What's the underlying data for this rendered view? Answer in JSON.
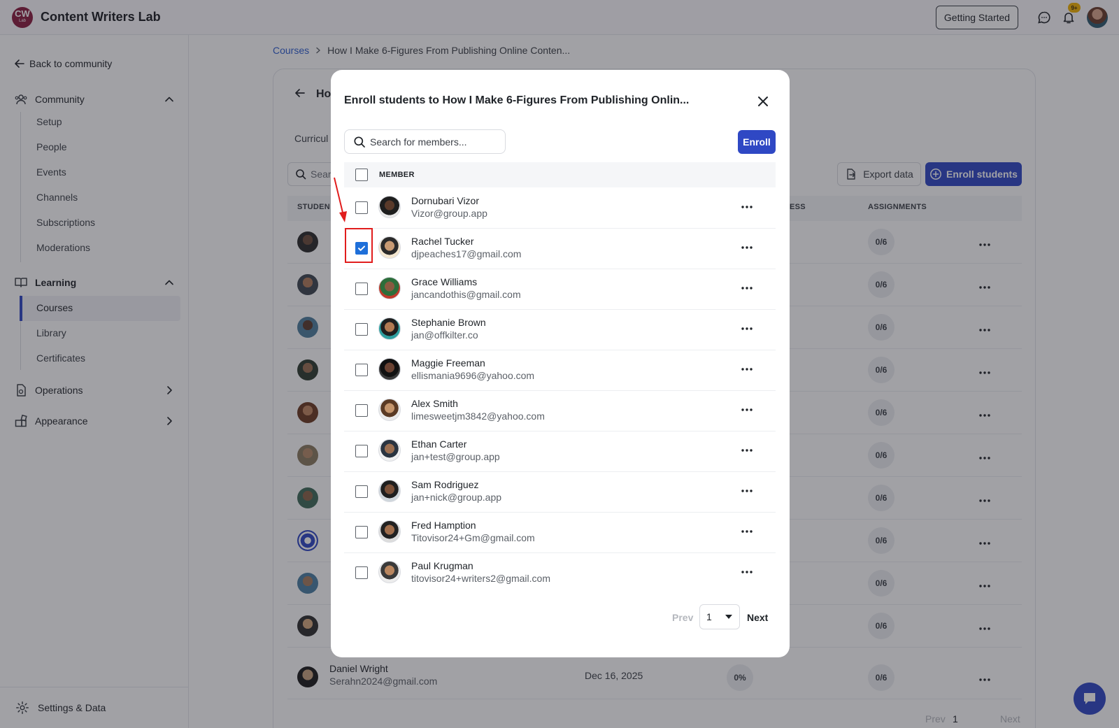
{
  "topbar": {
    "logo_text": "CW",
    "logo_sub": "Lab",
    "brand_name": "Content Writers Lab",
    "getting_started": "Getting Started",
    "notif_badge": "9+"
  },
  "sidebar": {
    "back_label": "Back to community",
    "community": {
      "label": "Community",
      "items": [
        "Setup",
        "People",
        "Events",
        "Channels",
        "Subscriptions",
        "Moderations"
      ]
    },
    "learning": {
      "label": "Learning",
      "items": [
        "Courses",
        "Library",
        "Certificates"
      ],
      "active": "Courses"
    },
    "operations": "Operations",
    "appearance": "Appearance",
    "settings": "Settings & Data"
  },
  "main": {
    "breadcrumb_root": "Courses",
    "breadcrumb_current": "How I Make 6-Figures From Publishing Online Conten...",
    "title_partial": "Ho",
    "tab_partial": "Curricul",
    "search_partial": "Sear",
    "export_label": "Export data",
    "enroll_students_label": "Enroll students",
    "columns": {
      "student": "STUDEN",
      "progress": "ESS",
      "assignments": "ASSIGNMENTS"
    },
    "assignments_value": "0/6",
    "last_row": {
      "name": "Daniel Wright",
      "email": "Serahn2024@gmail.com",
      "date": "Dec 16, 2025",
      "progress": "0%",
      "assignments": "0/6"
    },
    "pager": {
      "prev": "Prev",
      "page": "1",
      "next": "Next"
    }
  },
  "modal": {
    "title": "Enroll students to How I Make 6-Figures From Publishing Onlin...",
    "search_placeholder": "Search for members...",
    "enroll_label": "Enroll",
    "column_member": "MEMBER",
    "members": [
      {
        "name": "Dornubari Vizor",
        "email": "Vizor@group.app",
        "checked": false
      },
      {
        "name": "Rachel Tucker",
        "email": "djpeaches17@gmail.com",
        "checked": true
      },
      {
        "name": "Grace Williams",
        "email": "jancandothis@gmail.com",
        "checked": false
      },
      {
        "name": "Stephanie Brown",
        "email": "jan@offkilter.co",
        "checked": false
      },
      {
        "name": "Maggie Freeman",
        "email": "ellismania9696@yahoo.com",
        "checked": false
      },
      {
        "name": "Alex Smith",
        "email": "limesweetjm3842@yahoo.com",
        "checked": false
      },
      {
        "name": "Ethan Carter",
        "email": "jan+test@group.app",
        "checked": false
      },
      {
        "name": "Sam Rodriguez",
        "email": "jan+nick@group.app",
        "checked": false
      },
      {
        "name": "Fred Hamption",
        "email": "Titovisor24+Gm@gmail.com",
        "checked": false
      },
      {
        "name": "Paul Krugman",
        "email": "titovisor24+writers2@gmail.com",
        "checked": false
      }
    ],
    "pager": {
      "prev": "Prev",
      "page": "1",
      "next": "Next"
    }
  },
  "colors": {
    "primary": "#2f48c4",
    "checkbox_checked": "#1e6fd9",
    "annotation_red": "#e11d1d",
    "brand_logo": "#8b1d3f"
  }
}
